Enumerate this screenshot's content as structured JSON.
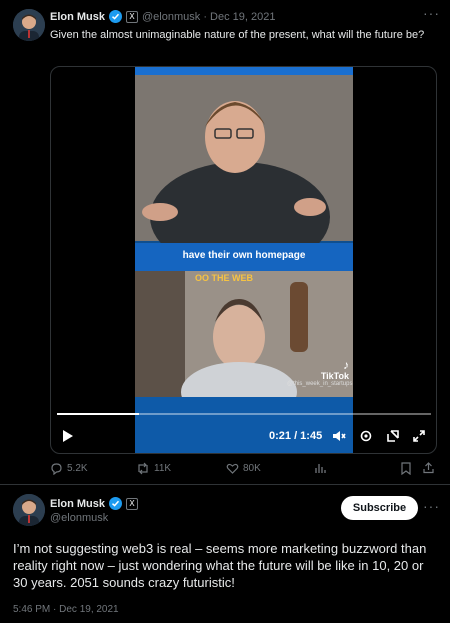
{
  "quoted_tweet": {
    "author_name": "Elon Musk",
    "handle_and_date": "@elonmusk · Dec 19, 2021",
    "text": "Given the almost unimaginable nature of the present, what will the future be?",
    "video": {
      "caption": "have their own homepage",
      "top_text": "OO THE WEB",
      "watermark_brand": "TikTok",
      "watermark_user": "@this_week_in_startups",
      "time": "0:21 / 1:45",
      "progress": 0.22
    },
    "stats": {
      "replies": "5.2K",
      "reposts": "11K",
      "likes": "80K"
    }
  },
  "main_tweet": {
    "author_name": "Elon Musk",
    "handle": "@elonmusk",
    "subscribe_label": "Subscribe",
    "text": "I’m not suggesting web3 is real – seems more marketing buzzword than reality right now – just wondering what the future will be like in 10, 20 or 30 years. 2051 sounds crazy futuristic!",
    "timestamp": "5:46 PM · Dec 19, 2021"
  },
  "icons": {
    "verified": "verified-badge-icon",
    "affiliate": "x-affiliate-icon",
    "more": "more-dots-icon"
  },
  "colors": {
    "background": "#000000",
    "text": "#e7e9ea",
    "muted": "#71767b",
    "accent": "#1d9bf0",
    "video_blue": "#0f4f8f"
  }
}
